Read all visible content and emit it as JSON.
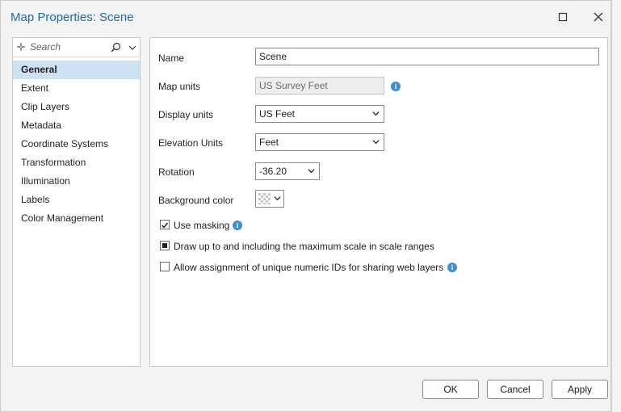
{
  "dialog": {
    "title": "Map Properties: Scene",
    "maximize_icon": "maximize-icon",
    "close_icon": "close-icon"
  },
  "sidebar": {
    "search": {
      "placeholder": "Search",
      "icon": "search-icon",
      "dropdown_icon": "chevron-down-icon"
    },
    "items": [
      {
        "label": "General",
        "active": true
      },
      {
        "label": "Extent"
      },
      {
        "label": "Clip Layers"
      },
      {
        "label": "Metadata"
      },
      {
        "label": "Coordinate Systems"
      },
      {
        "label": "Transformation"
      },
      {
        "label": "Illumination"
      },
      {
        "label": "Labels"
      },
      {
        "label": "Color Management"
      }
    ]
  },
  "general": {
    "name_label": "Name",
    "name_value": "Scene",
    "map_units_label": "Map units",
    "map_units_value": "US Survey Feet",
    "display_units_label": "Display units",
    "display_units_value": "US Feet",
    "elevation_units_label": "Elevation Units",
    "elevation_units_value": "Feet",
    "rotation_label": "Rotation",
    "rotation_value": "-36.20",
    "background_color_label": "Background color",
    "use_masking_label": "Use masking",
    "use_masking_checked": true,
    "draw_up_label": "Draw up to and including the maximum scale in scale ranges",
    "draw_up_state": "indeterminate",
    "allow_ids_label": "Allow assignment of unique numeric IDs for sharing web layers",
    "allow_ids_checked": false,
    "info_icon": "info-icon",
    "info_glyph": "i"
  },
  "buttons": {
    "ok": "OK",
    "cancel": "Cancel",
    "apply": "Apply"
  },
  "colors": {
    "accent": "#1e6aa8",
    "selection": "#cde1f3",
    "info": "#3d8ed4"
  }
}
